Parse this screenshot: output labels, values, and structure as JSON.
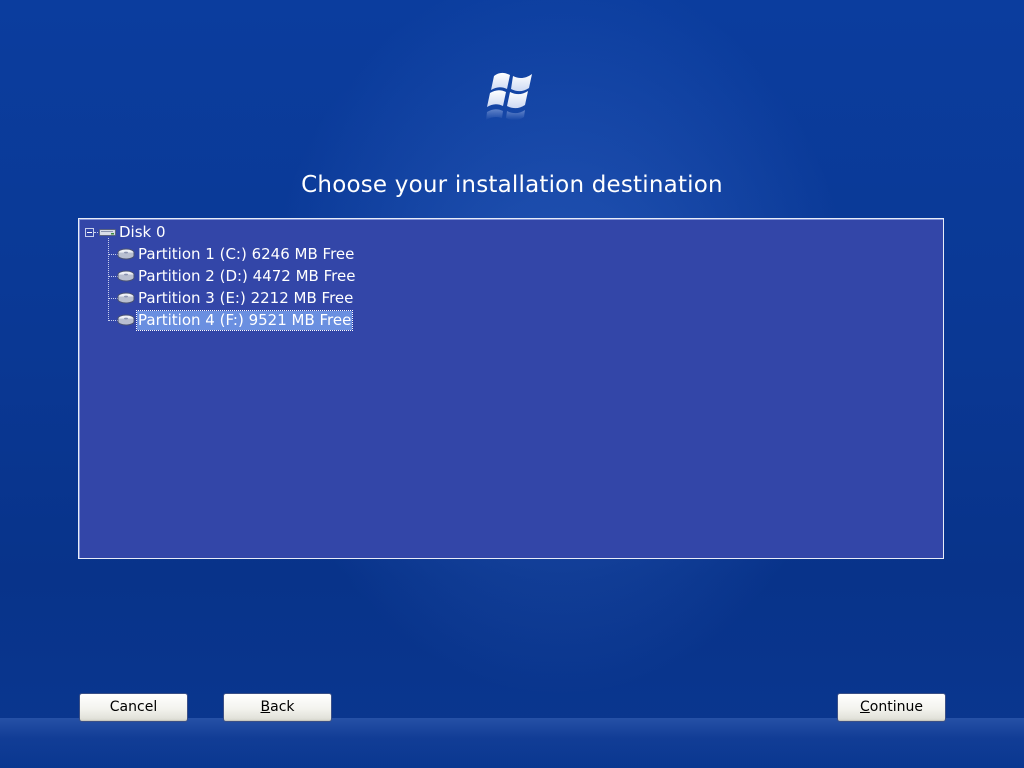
{
  "window": {
    "title": "Choose your installation destination"
  },
  "logo": {
    "icon": "windows-flag-icon"
  },
  "tree": {
    "disk": {
      "label": "Disk 0",
      "icon": "hard-disk-icon",
      "expanded": true
    },
    "partitions": [
      {
        "label": "Partition 1 (C:) 6246 MB Free",
        "icon": "drive-icon",
        "selected": false
      },
      {
        "label": "Partition 2 (D:) 4472 MB Free",
        "icon": "drive-icon",
        "selected": false
      },
      {
        "label": "Partition 3 (E:) 2212 MB Free",
        "icon": "drive-icon",
        "selected": false
      },
      {
        "label": "Partition 4 (F:) 9521 MB Free",
        "icon": "drive-icon",
        "selected": true
      }
    ]
  },
  "buttons": {
    "cancel": {
      "label": "Cancel"
    },
    "back": {
      "accel": "B",
      "rest": "ack"
    },
    "continue": {
      "accel": "C",
      "rest": "ontinue"
    }
  },
  "colors": {
    "background": "#0a3a96",
    "panel": "#3346a8",
    "selection": "#6a8fe0"
  }
}
